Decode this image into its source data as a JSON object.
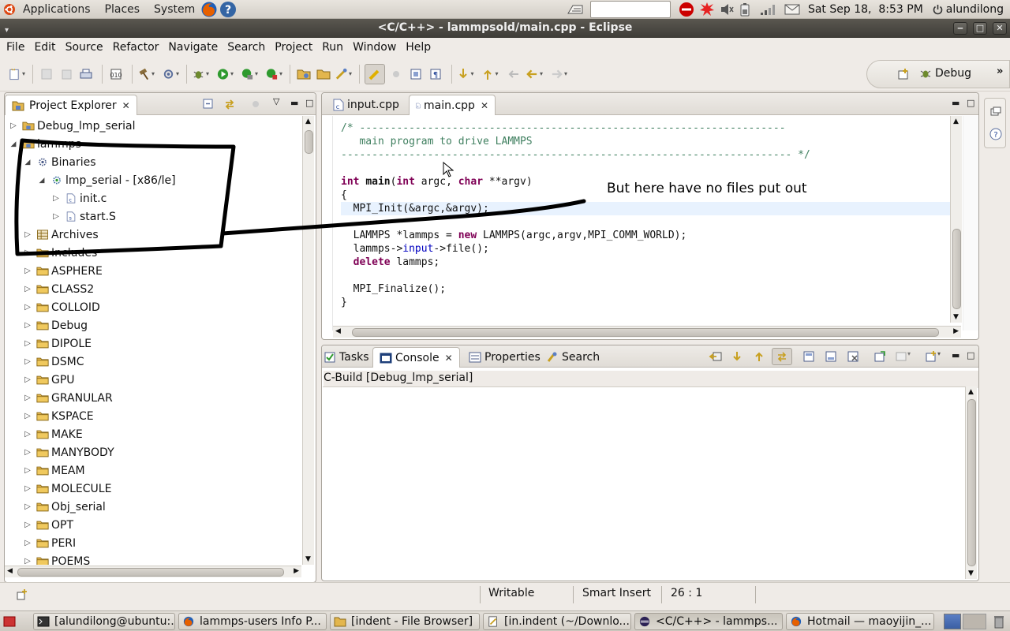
{
  "top_panel": {
    "menus": [
      "Applications",
      "Places",
      "System"
    ],
    "clock": "Sat Sep 18,  8:53 PM",
    "user": "alundilong"
  },
  "window": {
    "title": "<C/C++> - lammpsold/main.cpp - Eclipse"
  },
  "menubar": {
    "items": [
      {
        "label": "File",
        "u": "F",
        "rest": "ile"
      },
      {
        "label": "Edit",
        "u": "E",
        "rest": "dit"
      },
      {
        "label": "Source",
        "u": "S",
        "rest": "ource"
      },
      {
        "label": "Refactor",
        "u": "",
        "rest": "Refactor"
      },
      {
        "label": "Navigate",
        "u": "N",
        "rest": "avigate"
      },
      {
        "label": "Search",
        "u": "",
        "rest": "Search"
      },
      {
        "label": "Project",
        "u": "P",
        "rest": "roject"
      },
      {
        "label": "Run",
        "u": "R",
        "rest": "un"
      },
      {
        "label": "Window",
        "u": "W",
        "rest": "indow"
      },
      {
        "label": "Help",
        "u": "H",
        "rest": "elp"
      }
    ]
  },
  "perspective": {
    "label": "Debug"
  },
  "project_explorer": {
    "title": "Project Explorer",
    "items": [
      {
        "label": "Debug_lmp_serial",
        "depth": 0,
        "expander": "collapsed",
        "icon": "project-icon"
      },
      {
        "label": "lammps",
        "depth": 0,
        "expander": "expanded",
        "icon": "project-icon"
      },
      {
        "label": "Binaries",
        "depth": 1,
        "expander": "expanded",
        "icon": "binaries-icon"
      },
      {
        "label": "lmp_serial - [x86/le]",
        "depth": 2,
        "expander": "expanded",
        "icon": "binary-icon"
      },
      {
        "label": "init.c",
        "depth": 3,
        "expander": "collapsed",
        "icon": "c-file-icon"
      },
      {
        "label": "start.S",
        "depth": 3,
        "expander": "collapsed",
        "icon": "asm-file-icon"
      },
      {
        "label": "Archives",
        "depth": 1,
        "expander": "collapsed",
        "icon": "archives-icon"
      },
      {
        "label": "Includes",
        "depth": 1,
        "expander": "collapsed",
        "icon": "includes-icon"
      },
      {
        "label": "ASPHERE",
        "depth": 1,
        "expander": "collapsed",
        "icon": "folder-icon"
      },
      {
        "label": "CLASS2",
        "depth": 1,
        "expander": "collapsed",
        "icon": "folder-icon"
      },
      {
        "label": "COLLOID",
        "depth": 1,
        "expander": "collapsed",
        "icon": "folder-icon"
      },
      {
        "label": "Debug",
        "depth": 1,
        "expander": "collapsed",
        "icon": "folder-icon"
      },
      {
        "label": "DIPOLE",
        "depth": 1,
        "expander": "collapsed",
        "icon": "folder-icon"
      },
      {
        "label": "DSMC",
        "depth": 1,
        "expander": "collapsed",
        "icon": "folder-icon"
      },
      {
        "label": "GPU",
        "depth": 1,
        "expander": "collapsed",
        "icon": "folder-icon"
      },
      {
        "label": "GRANULAR",
        "depth": 1,
        "expander": "collapsed",
        "icon": "folder-icon"
      },
      {
        "label": "KSPACE",
        "depth": 1,
        "expander": "collapsed",
        "icon": "folder-icon"
      },
      {
        "label": "MAKE",
        "depth": 1,
        "expander": "collapsed",
        "icon": "folder-icon"
      },
      {
        "label": "MANYBODY",
        "depth": 1,
        "expander": "collapsed",
        "icon": "folder-icon"
      },
      {
        "label": "MEAM",
        "depth": 1,
        "expander": "collapsed",
        "icon": "folder-icon"
      },
      {
        "label": "MOLECULE",
        "depth": 1,
        "expander": "collapsed",
        "icon": "folder-icon"
      },
      {
        "label": "Obj_serial",
        "depth": 1,
        "expander": "collapsed",
        "icon": "folder-icon"
      },
      {
        "label": "OPT",
        "depth": 1,
        "expander": "collapsed",
        "icon": "folder-icon"
      },
      {
        "label": "PERI",
        "depth": 1,
        "expander": "collapsed",
        "icon": "folder-icon"
      },
      {
        "label": "POEMS",
        "depth": 1,
        "expander": "collapsed",
        "icon": "folder-icon"
      }
    ]
  },
  "editor": {
    "tabs": [
      {
        "label": "input.cpp",
        "active": false
      },
      {
        "label": "main.cpp",
        "active": true
      }
    ],
    "lines": [
      [
        {
          "t": "/* ---------------------------------------------------------------------",
          "c": "cm"
        }
      ],
      [
        {
          "t": "   main program to drive LAMMPS",
          "c": "cm"
        }
      ],
      [
        {
          "t": "------------------------------------------------------------------------- */",
          "c": "cm"
        }
      ],
      [],
      [
        {
          "t": "int",
          "c": "kw"
        },
        {
          "t": " "
        },
        {
          "t": "main",
          "c": "fn"
        },
        {
          "t": "("
        },
        {
          "t": "int",
          "c": "kw"
        },
        {
          "t": " argc, "
        },
        {
          "t": "char",
          "c": "kw"
        },
        {
          "t": " **argv)"
        }
      ],
      [
        {
          "t": "{"
        }
      ],
      [
        {
          "t": "  MPI_Init(&argc,&argv);"
        }
      ],
      [],
      [
        {
          "t": "  LAMMPS *lammps = "
        },
        {
          "t": "new",
          "c": "kw"
        },
        {
          "t": " LAMMPS(argc,argv,MPI_COMM_WORLD);"
        }
      ],
      [
        {
          "t": "  lammps->"
        },
        {
          "t": "input",
          "c": "mem"
        },
        {
          "t": "->file();"
        }
      ],
      [
        {
          "t": "  "
        },
        {
          "t": "delete",
          "c": "kw"
        },
        {
          "t": " lammps;"
        }
      ],
      [],
      [
        {
          "t": "  MPI_Finalize();"
        }
      ],
      [
        {
          "t": "}"
        }
      ]
    ]
  },
  "annotation": {
    "text": "But here have no files put out"
  },
  "console_view": {
    "tabs": [
      "Tasks",
      "Console",
      "Properties",
      "Search"
    ],
    "active_tab": "Console",
    "header": "C-Build [Debug_lmp_serial]"
  },
  "status_bar": {
    "writable": "Writable",
    "insert_mode": "Smart Insert",
    "position": "26 : 1"
  },
  "taskbar": {
    "items": [
      {
        "label": "[alundilong@ubuntu:...",
        "icon": "terminal-icon"
      },
      {
        "label": "lammps-users Info P...",
        "icon": "firefox-icon"
      },
      {
        "label": "[indent - File Browser]",
        "icon": "folder-icon"
      },
      {
        "label": "[in.indent (~/Downlo...",
        "icon": "text-editor-icon"
      },
      {
        "label": "<C/C++> - lammps...",
        "icon": "eclipse-icon"
      },
      {
        "label": "Hotmail — maoyijin_...",
        "icon": "firefox-icon"
      }
    ]
  },
  "colors": {
    "comment": "#3f7f5f",
    "keyword": "#7f0055",
    "member": "#0000c0",
    "current_line": "#e8f2fe",
    "titlebar": "#3e3c37"
  }
}
